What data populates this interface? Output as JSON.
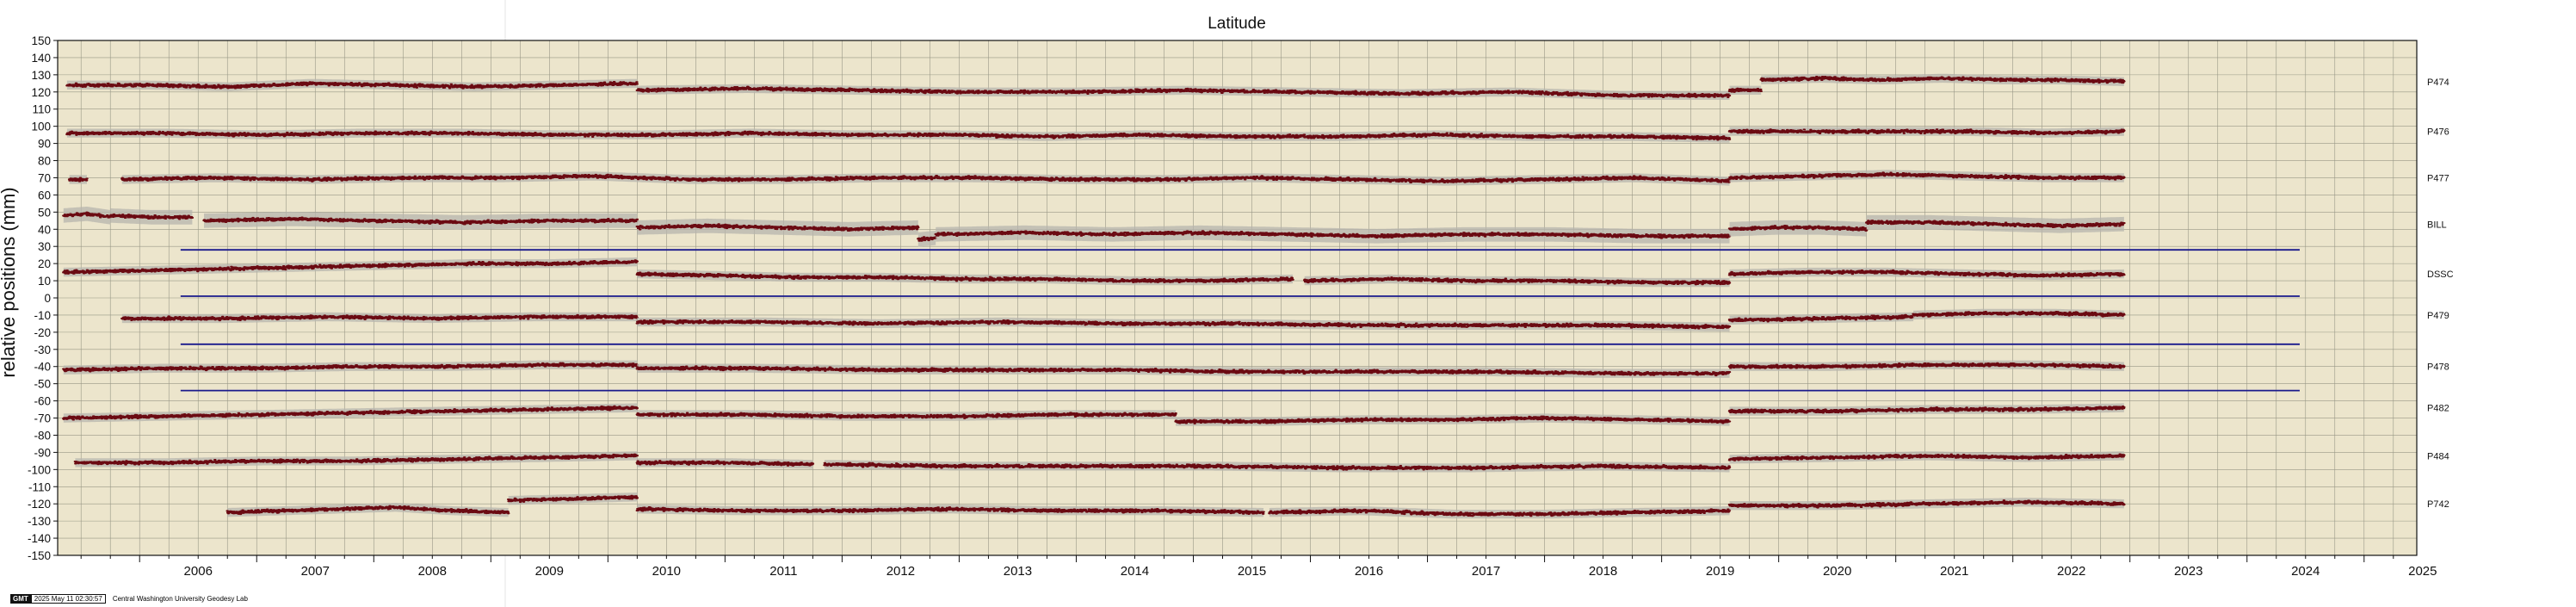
{
  "chart_data": {
    "type": "scatter",
    "title": "Latitude",
    "ylabel": "relative positions (mm)",
    "xlabel": "",
    "xlim": [
      2005.3,
      2025.45
    ],
    "ylim": [
      -150,
      150
    ],
    "y_ticks": [
      150,
      140,
      130,
      120,
      110,
      100,
      90,
      80,
      70,
      60,
      50,
      40,
      30,
      20,
      10,
      0,
      -10,
      -20,
      -30,
      -40,
      -50,
      -60,
      -70,
      -80,
      -90,
      -100,
      -110,
      -120,
      -130,
      -140,
      -150
    ],
    "x_ticks": [
      "2006",
      "2007",
      "2008",
      "2009",
      "2010",
      "2011",
      "2012",
      "2013",
      "2014",
      "2015",
      "2016",
      "2017",
      "2018",
      "2019",
      "2020",
      "2021",
      "2022",
      "2023",
      "2024",
      "2025"
    ],
    "grid": true,
    "series": [
      {
        "name": "P474",
        "segments": [
          {
            "start": 2005.38,
            "end": 2010.25,
            "values": [
              124,
              124,
              123,
              125,
              124,
              123,
              124,
              125
            ]
          },
          {
            "start": 2010.25,
            "end": 2019.58,
            "values": [
              121,
              122,
              121,
              120,
              120,
              121,
              120,
              119,
              120,
              118,
              118
            ]
          },
          {
            "start": 2019.58,
            "end": 2019.85,
            "values": [
              121,
              121
            ]
          },
          {
            "start": 2019.85,
            "end": 2022.95,
            "values": [
              127,
              128,
              127,
              128,
              127,
              127,
              126
            ]
          }
        ]
      },
      {
        "name": "P476",
        "segments": [
          {
            "start": 2005.38,
            "end": 2019.58,
            "values": [
              96,
              96,
              95,
              96,
              96,
              95,
              95,
              96,
              95,
              95,
              94,
              95,
              94,
              94,
              95,
              94,
              94,
              93
            ]
          },
          {
            "start": 2019.58,
            "end": 2022.95,
            "values": [
              97,
              97,
              97,
              97,
              96,
              97
            ]
          }
        ]
      },
      {
        "name": "P477",
        "segments": [
          {
            "start": 2005.4,
            "end": 2005.55,
            "values": [
              69,
              69
            ]
          },
          {
            "start": 2005.85,
            "end": 2019.58,
            "values": [
              69,
              70,
              69,
              70,
              70,
              71,
              69,
              69,
              70,
              70,
              69,
              69,
              70,
              69,
              68,
              69,
              70,
              68
            ]
          },
          {
            "start": 2019.58,
            "end": 2022.95,
            "values": [
              70,
              71,
              72,
              71,
              70,
              70
            ]
          }
        ]
      },
      {
        "name": "BILL",
        "segments": [
          {
            "start": 2005.35,
            "end": 2005.75,
            "values": [
              48,
              49,
              47
            ]
          },
          {
            "start": 2005.75,
            "end": 2006.45,
            "values": [
              48,
              47,
              47
            ]
          },
          {
            "start": 2006.55,
            "end": 2010.25,
            "values": [
              45,
              46,
              45,
              44,
              45,
              45
            ]
          },
          {
            "start": 2010.25,
            "end": 2012.65,
            "values": [
              41,
              42,
              41,
              40,
              41
            ]
          },
          {
            "start": 2012.65,
            "end": 2012.8,
            "values": [
              34,
              35
            ]
          },
          {
            "start": 2012.8,
            "end": 2019.58,
            "values": [
              37,
              38,
              37,
              38,
              37,
              36,
              37,
              37,
              36,
              36
            ]
          },
          {
            "start": 2019.58,
            "end": 2020.75,
            "values": [
              40,
              41,
              41,
              40
            ]
          },
          {
            "start": 2020.75,
            "end": 2022.95,
            "values": [
              44,
              44,
              43,
              42,
              43
            ]
          }
        ]
      },
      {
        "name": "DSSC",
        "segments": [
          {
            "start": 2005.35,
            "end": 2010.25,
            "values": [
              15,
              16,
              17,
              18,
              19,
              20,
              20,
              21
            ]
          },
          {
            "start": 2010.25,
            "end": 2015.85,
            "values": [
              14,
              13,
              12,
              12,
              11,
              11,
              10,
              10,
              11
            ]
          },
          {
            "start": 2015.95,
            "end": 2019.58,
            "values": [
              10,
              11,
              10,
              10,
              9,
              9
            ]
          },
          {
            "start": 2019.58,
            "end": 2022.95,
            "values": [
              14,
              15,
              15,
              14,
              13,
              14
            ]
          }
        ]
      },
      {
        "name": "P479",
        "segments": [
          {
            "start": 2005.85,
            "end": 2010.25,
            "values": [
              -12,
              -12,
              -11,
              -12,
              -11,
              -11
            ]
          },
          {
            "start": 2010.25,
            "end": 2019.58,
            "values": [
              -14,
              -14,
              -15,
              -14,
              -15,
              -15,
              -16,
              -16,
              -16,
              -17
            ]
          },
          {
            "start": 2019.58,
            "end": 2021.15,
            "values": [
              -13,
              -12,
              -11
            ]
          },
          {
            "start": 2021.15,
            "end": 2022.95,
            "values": [
              -10,
              -9,
              -9,
              -10
            ]
          }
        ]
      },
      {
        "name": "P478",
        "segments": [
          {
            "start": 2005.35,
            "end": 2010.25,
            "values": [
              -42,
              -41,
              -41,
              -40,
              -40,
              -39,
              -39
            ]
          },
          {
            "start": 2010.25,
            "end": 2019.58,
            "values": [
              -41,
              -41,
              -42,
              -42,
              -42,
              -43,
              -43,
              -43,
              -44,
              -44
            ]
          },
          {
            "start": 2019.58,
            "end": 2022.95,
            "values": [
              -40,
              -40,
              -39,
              -39,
              -40
            ]
          }
        ]
      },
      {
        "name": "P482",
        "segments": [
          {
            "start": 2005.35,
            "end": 2010.25,
            "values": [
              -70,
              -69,
              -68,
              -67,
              -66,
              -65,
              -64
            ]
          },
          {
            "start": 2010.25,
            "end": 2014.85,
            "values": [
              -68,
              -68,
              -69,
              -69,
              -68,
              -68
            ]
          },
          {
            "start": 2014.85,
            "end": 2019.58,
            "values": [
              -72,
              -72,
              -71,
              -71,
              -70,
              -71,
              -72
            ]
          },
          {
            "start": 2019.58,
            "end": 2022.95,
            "values": [
              -66,
              -66,
              -65,
              -65,
              -64
            ]
          }
        ]
      },
      {
        "name": "P484",
        "segments": [
          {
            "start": 2005.45,
            "end": 2010.25,
            "values": [
              -96,
              -96,
              -95,
              -95,
              -94,
              -93,
              -92
            ]
          },
          {
            "start": 2010.25,
            "end": 2011.75,
            "values": [
              -96,
              -96,
              -97
            ]
          },
          {
            "start": 2011.85,
            "end": 2019.58,
            "values": [
              -97,
              -98,
              -98,
              -98,
              -99,
              -99,
              -98,
              -99
            ]
          },
          {
            "start": 2019.58,
            "end": 2022.95,
            "values": [
              -94,
              -93,
              -92,
              -93,
              -92
            ]
          }
        ]
      },
      {
        "name": "P742",
        "segments": [
          {
            "start": 2006.75,
            "end": 2009.15,
            "values": [
              -125,
              -124,
              -123,
              -122,
              -124,
              -125
            ]
          },
          {
            "start": 2009.15,
            "end": 2010.25,
            "values": [
              -118,
              -117,
              -116
            ]
          },
          {
            "start": 2010.25,
            "end": 2015.6,
            "values": [
              -123,
              -124,
              -124,
              -123,
              -124,
              -124,
              -125
            ]
          },
          {
            "start": 2015.65,
            "end": 2019.58,
            "values": [
              -125,
              -124,
              -126,
              -126,
              -125,
              -124
            ]
          },
          {
            "start": 2019.58,
            "end": 2022.95,
            "values": [
              -121,
              -121,
              -120,
              -119,
              -120
            ]
          }
        ]
      }
    ],
    "reference_lines": [
      {
        "y": 28,
        "start": 2006.35,
        "end": 2024.45,
        "color": "#1a1a8c"
      },
      {
        "y": 1,
        "start": 2006.35,
        "end": 2024.45,
        "color": "#1a1a8c"
      },
      {
        "y": -27,
        "start": 2006.35,
        "end": 2024.45,
        "color": "#1a1a8c"
      },
      {
        "y": -54,
        "start": 2006.35,
        "end": 2024.45,
        "color": "#1a1a8c"
      }
    ],
    "colors": {
      "background": "#ece5cc",
      "grid": "#8a8a7a",
      "points": "#6b0a12",
      "uncertainty": "#b7b4ad",
      "reference": "#1a1a8c"
    }
  },
  "footer": {
    "logo": "GMT",
    "timestamp": "2025 May 11 02:30:57",
    "lab": "Central Washington University Geodesy Lab"
  }
}
